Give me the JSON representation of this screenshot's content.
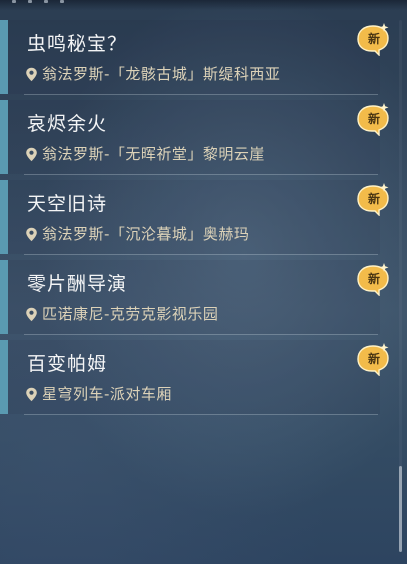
{
  "colors": {
    "accent_bar": "#5a9ab1",
    "title_text": "#f3f4f5",
    "location_text": "#dcd2b8",
    "badge_gold": "#f2bb4a"
  },
  "list": {
    "items": [
      {
        "title": "虫鸣秘宝？",
        "location": "翁法罗斯-「龙骸古城」斯缇科西亚",
        "badge": "新",
        "icon": "location-pin-icon"
      },
      {
        "title": "哀烬余火",
        "location": "翁法罗斯-「无晖祈堂」黎明云崖",
        "badge": "新",
        "icon": "location-pin-icon"
      },
      {
        "title": "天空旧诗",
        "location": "翁法罗斯-「沉沦暮城」奥赫玛",
        "badge": "新",
        "icon": "location-pin-icon"
      },
      {
        "title": "零片酬导演",
        "location": "匹诺康尼-克劳克影视乐园",
        "badge": "新",
        "icon": "location-pin-icon"
      },
      {
        "title": "百变帕姆",
        "location": "星穹列车-派对车厢",
        "badge": "新",
        "icon": "location-pin-icon"
      }
    ]
  }
}
